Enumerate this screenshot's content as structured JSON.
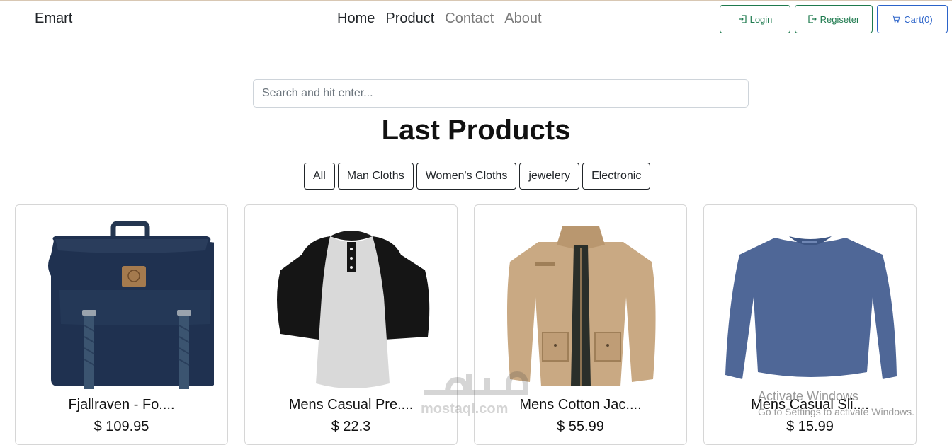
{
  "navbar": {
    "brand": "Emart",
    "links": [
      {
        "label": "Home"
      },
      {
        "label": "Product"
      },
      {
        "label": "Contact"
      },
      {
        "label": "About"
      }
    ],
    "login_label": "Login",
    "register_label": "Regiseter",
    "cart_label": "Cart(0)"
  },
  "search": {
    "placeholder": "Search and hit enter..."
  },
  "page_title": "Last Products",
  "filters": [
    "All",
    "Man Cloths",
    "Women's Cloths",
    "jewelery",
    "Electronic"
  ],
  "products": [
    {
      "title": "Fjallraven - Fo....",
      "price": "$ 109.95",
      "image": "backpack"
    },
    {
      "title": "Mens Casual Pre....",
      "price": "$ 22.3",
      "image": "raglan-tshirt"
    },
    {
      "title": "Mens Cotton Jac....",
      "price": "$ 55.99",
      "image": "jacket"
    },
    {
      "title": "Mens Casual Sli....",
      "price": "$ 15.99",
      "image": "long-sleeve-shirt"
    }
  ],
  "watermarks": {
    "mostaql_latin": "mostaql.com",
    "windows_line1": "Activate Windows",
    "windows_line2": "Go to Settings to activate Windows."
  },
  "colors": {
    "login_border": "#1e7a4e",
    "cart_border": "#2b63c9"
  }
}
